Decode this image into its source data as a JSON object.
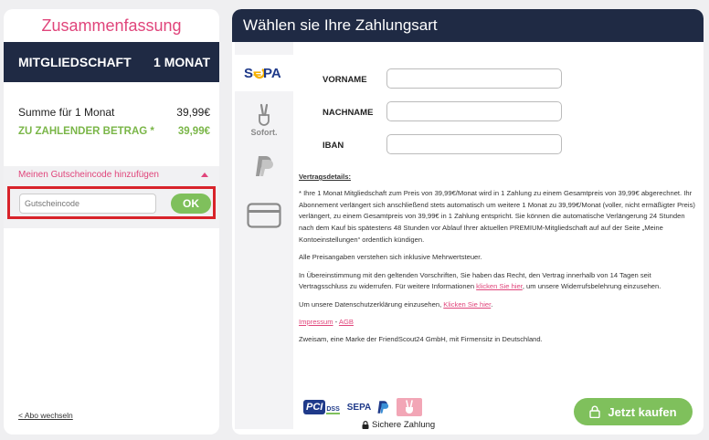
{
  "summary": {
    "title": "Zusammenfassung",
    "plan_label": "MITGLIEDSCHAFT",
    "plan_duration": "1 MONAT",
    "sum_label": "Summe für 1 Monat",
    "sum_value": "39,99€",
    "total_label": "ZU ZAHLENDER BETRAG *",
    "total_value": "39,99€",
    "coupon_link": "Meinen Gutscheincode hinzufügen",
    "coupon_placeholder": "Gutscheincode",
    "ok_label": "OK",
    "abo_link": "< Abo wechseln"
  },
  "payment": {
    "title": "Wählen sie Ihre Zahlungsart",
    "methods": [
      {
        "name": "sepa",
        "label": "SEPA"
      },
      {
        "name": "sofort",
        "label": "Sofort."
      },
      {
        "name": "paypal",
        "label": ""
      },
      {
        "name": "card",
        "label": ""
      }
    ],
    "form": {
      "vorname_label": "VORNAME",
      "nachname_label": "NACHNAME",
      "iban_label": "IBAN"
    },
    "terms": {
      "heading": "Vertragsdetails:",
      "p1": "* Ihre 1 Monat Mitgliedschaft zum Preis von 39,99€/Monat wird in 1 Zahlung zu einem Gesamtpreis von 39,99€ abgerechnet. Ihr Abonnement verlängert sich anschließend stets automatisch um weitere 1 Monat zu 39,99€/Monat (voller, nicht ermäßigter Preis) verlängert, zu einem Gesamtpreis von 39,99€ in 1 Zahlung entspricht. Sie können die automatische Verlängerung 24 Stunden nach dem Kauf bis spätestens 48 Stunden vor Ablauf Ihrer aktuellen PREMIUM-Mitgliedschaft auf auf der Seite „Meine Kontoeinstellungen“ ordentlich kündigen.",
      "p2": "Alle Preisangaben verstehen sich inklusive Mehrwertsteuer.",
      "p3_a": "In Übereinstimmung mit den geltenden Vorschriften, Sie haben das Recht, den Vertrag innerhalb von 14 Tagen seit Vertragsschluss zu widerrufen. Für weitere Informationen ",
      "p3_link": "klicken Sie hier",
      "p3_b": ", um unsere Widerrufsbelehrung einzusehen.",
      "p4_a": "Um unsere Datenschutzerklärung einzusehen, ",
      "p4_link": "Klicken Sie hier",
      "p4_b": ".",
      "impressum": "Impressum",
      "sep": " - ",
      "agb": "AGB",
      "p6": "Zweisam, eine Marke der FriendScout24 GmbH, mit Firmensitz in Deutschland."
    },
    "badges": {
      "pci": "PCI",
      "dss": "DSS",
      "sepa": "SEPA"
    },
    "secure_label": "Sichere Zahlung",
    "buy_label": "Jetzt kaufen"
  },
  "colors": {
    "navy": "#1f2a44",
    "pink": "#e0457b",
    "green": "#7fc05c",
    "highlight_red": "#d8232a"
  }
}
